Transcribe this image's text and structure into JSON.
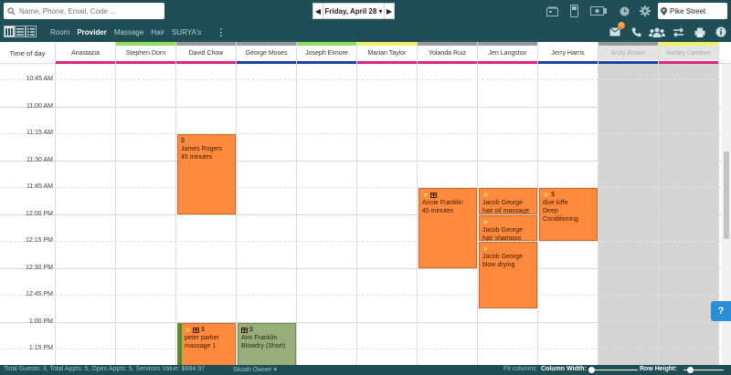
{
  "search": {
    "placeholder": "Name, Phone, Email, Code ..."
  },
  "date_nav": {
    "prev": "◀",
    "label": "Friday, April 28 ▾",
    "next": "▶"
  },
  "location": {
    "label": "Pike Street"
  },
  "toolbar": {
    "tabs": [
      {
        "label": "Room",
        "active": false
      },
      {
        "label": "Provider",
        "active": true
      },
      {
        "label": "Massage",
        "active": false
      },
      {
        "label": "Hair",
        "active": false
      },
      {
        "label": "SURYA's",
        "active": false
      }
    ],
    "kebab": "⋮",
    "message_badge": "0"
  },
  "grid": {
    "time_header": "Time of day",
    "providers": [
      {
        "name": "Anastazia",
        "top": "#ffffff",
        "bottom": "#e0247e",
        "off": false
      },
      {
        "name": "Stephen Dorn",
        "top": "#8ee05a",
        "bottom": "#e0247e",
        "off": false
      },
      {
        "name": "David Chow",
        "top": "#9a9a9a",
        "bottom": "#e0247e",
        "off": false
      },
      {
        "name": "George Moses",
        "top": "#9a9a9a",
        "bottom": "#1f3fa0",
        "off": false
      },
      {
        "name": "Joseph Elmore",
        "top": "#8ee05a",
        "bottom": "#1f3fa0",
        "off": false
      },
      {
        "name": "Marian Taylor",
        "top": "#f0f060",
        "bottom": "#e0247e",
        "off": false
      },
      {
        "name": "Yolanda Ruiz",
        "top": "#9a9a9a",
        "bottom": "#e0247e",
        "off": false
      },
      {
        "name": "Jen Langston",
        "top": "#9a9a9a",
        "bottom": "#e0247e",
        "off": false
      },
      {
        "name": "Jerry Harris",
        "top": "#ffffff",
        "bottom": "#1f3fa0",
        "off": false
      },
      {
        "name": "Andy Brown",
        "top": "#9a9a9a",
        "bottom": "#1f3fa0",
        "off": true
      },
      {
        "name": "Ashley Lambert",
        "top": "#f0f060",
        "bottom": "#e0247e",
        "off": true
      }
    ],
    "times": [
      "10:45 AM",
      "11:00 AM",
      "11:15 AM",
      "11:30 AM",
      "11:45 AM",
      "12:00 PM",
      "12:15 PM",
      "12:30 PM",
      "12:45 PM",
      "1:00 PM",
      "1:15 PM"
    ]
  },
  "appointments": [
    {
      "col": 2,
      "slot": 3,
      "slots": 3,
      "icons": "$",
      "star": false,
      "bag": false,
      "line1": "James Rogers",
      "line2": "45 minutes",
      "color": "orange"
    },
    {
      "col": 6,
      "slot": 5,
      "slots": 3,
      "icons": "",
      "star": true,
      "bag": true,
      "line1": "Annie Franklin",
      "line2": "45 minutes",
      "color": "orange"
    },
    {
      "col": 7,
      "slot": 5,
      "slots": 1,
      "icons": "",
      "star": true,
      "bag": false,
      "line1": "Jacob George",
      "line2": "hair oil massage",
      "color": "orange"
    },
    {
      "col": 7,
      "slot": 6,
      "slots": 1,
      "icons": "",
      "star": true,
      "bag": false,
      "line1": "Jacob George",
      "line2": "hair shampoo",
      "color": "orange"
    },
    {
      "col": 7,
      "slot": 7,
      "slots": 2.5,
      "icons": "",
      "star": true,
      "bag": false,
      "line1": "Jacob George",
      "line2": "blow drying",
      "color": "orange"
    },
    {
      "col": 8,
      "slot": 5,
      "slots": 2,
      "icons": "$",
      "star": true,
      "bag": false,
      "line1": "dive kiffe",
      "line2": "Deep Conditioning",
      "color": "orange"
    },
    {
      "col": 2,
      "slot": 10,
      "slots": 2,
      "icons": "$",
      "star": true,
      "bag": true,
      "line1": "peter parker",
      "line2": "massage 1",
      "color": "orange",
      "leftbar": true
    },
    {
      "col": 3,
      "slot": 10,
      "slots": 2,
      "icons": "$",
      "star": false,
      "bag": true,
      "line1": "Ann Franklin",
      "line2": "Blowdry (Short)",
      "color": "green"
    }
  ],
  "status": {
    "summary": "Total Guests: 3, Total Appts: 5, Open Appts: 5, Services Value: $684.97",
    "owner": "Skoah Owner ▾",
    "fit_columns": "Fit columns",
    "column_width": "Column Width:",
    "row_height": "Row Height:"
  },
  "help": {
    "label": "?"
  }
}
